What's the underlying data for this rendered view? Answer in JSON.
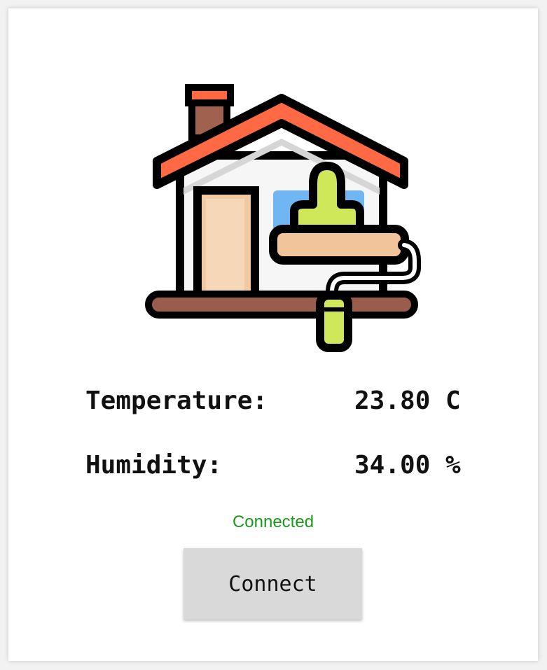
{
  "readings": {
    "temperature_label": "Temperature:",
    "temperature_value": "23.80 C",
    "humidity_label": "Humidity:",
    "humidity_value": "34.00 %"
  },
  "status": {
    "text": "Connected",
    "color": "#1a9a1a"
  },
  "actions": {
    "connect_label": "Connect"
  },
  "illustration": {
    "icon": "house-paint-roller-icon"
  }
}
